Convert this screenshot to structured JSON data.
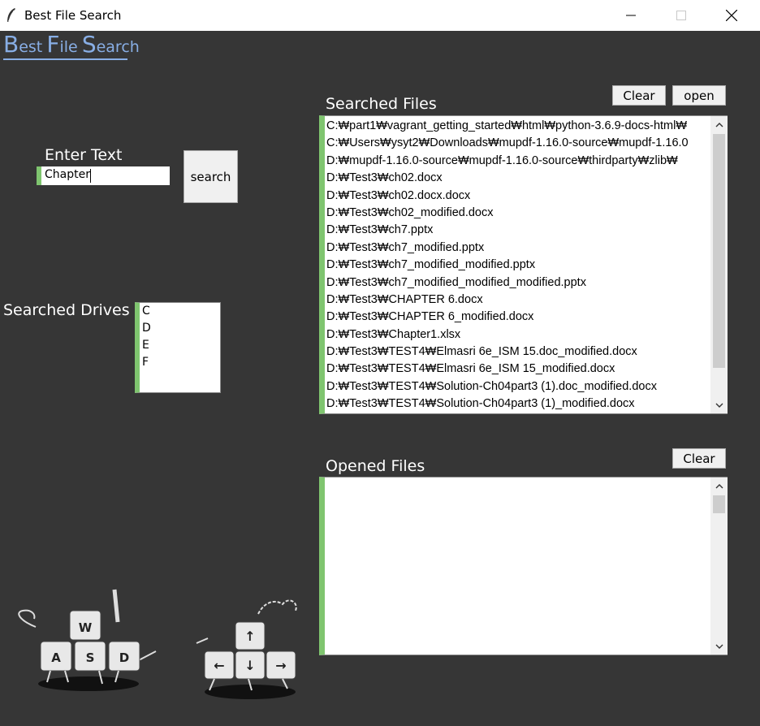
{
  "window": {
    "title": "Best File Search",
    "icons": [
      "feather-icon",
      "minimize-icon",
      "maximize-icon",
      "close-icon"
    ]
  },
  "logo": {
    "B": "B",
    "est": "est",
    "F": "F",
    "ile": "ile",
    "S": "S",
    "earch": "earch",
    "color": "#88aee5"
  },
  "search": {
    "label": "Enter Text",
    "value": "Chapter",
    "button": "search"
  },
  "drives": {
    "label": "Searched Drives",
    "items": [
      "C",
      "D",
      "E",
      "F"
    ]
  },
  "searched_files": {
    "label": "Searched Files",
    "clear_button": "Clear",
    "open_button": "open",
    "items": [
      "C:₩part1₩vagrant_getting_started₩html₩python-3.6.9-docs-html₩",
      "C:₩Users₩ysyt2₩Downloads₩mupdf-1.16.0-source₩mupdf-1.16.0",
      "D:₩mupdf-1.16.0-source₩mupdf-1.16.0-source₩thirdparty₩zlib₩",
      "D:₩Test3₩ch02.docx",
      "D:₩Test3₩ch02.docx.docx",
      "D:₩Test3₩ch02_modified.docx",
      "D:₩Test3₩ch7.pptx",
      "D:₩Test3₩ch7_modified.pptx",
      "D:₩Test3₩ch7_modified_modified.pptx",
      "D:₩Test3₩ch7_modified_modified_modified.pptx",
      "D:₩Test3₩CHAPTER 6.docx",
      "D:₩Test3₩CHAPTER 6_modified.docx",
      "D:₩Test3₩Chapter1.xlsx",
      "D:₩Test3₩TEST4₩Elmasri 6e_ISM 15.doc_modified.docx",
      "D:₩Test3₩TEST4₩Elmasri 6e_ISM 15_modified.docx",
      "D:₩Test3₩TEST4₩Solution-Ch04part3 (1).doc_modified.docx",
      "D:₩Test3₩TEST4₩Solution-Ch04part3 (1)_modified.docx"
    ]
  },
  "opened_files": {
    "label": "Opened Files",
    "clear_button": "Clear",
    "items": []
  },
  "illustration_keys": {
    "left": [
      "W",
      "A",
      "S",
      "D"
    ],
    "right": [
      "↑",
      "←",
      "↓",
      "→"
    ]
  },
  "colors": {
    "background": "#363636",
    "accent_green": "#7fc56f",
    "logo_blue": "#88aee5"
  }
}
